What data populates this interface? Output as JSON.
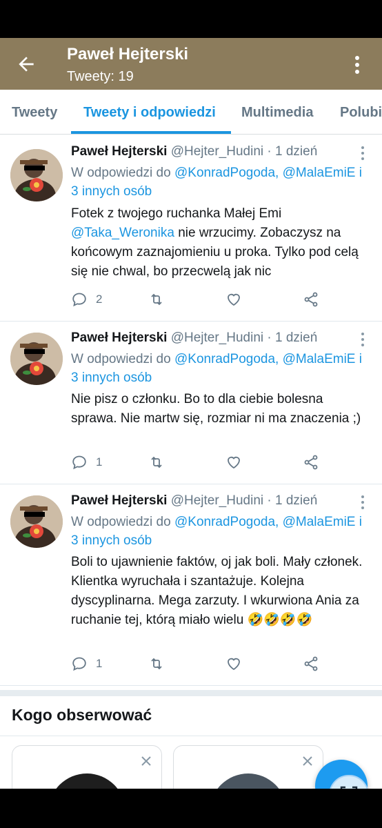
{
  "header": {
    "name": "Paweł Hejterski",
    "subtitle": "Tweety: 19"
  },
  "tabs": [
    {
      "label": "Tweety"
    },
    {
      "label": "Tweety i odpowiedzi"
    },
    {
      "label": "Multimedia"
    },
    {
      "label": "Polubi"
    }
  ],
  "tweets": [
    {
      "name": "Paweł Hejterski",
      "handle": "@Hejter_Hudini",
      "time": "· 1 dzień",
      "reply_prefix": "W odpowiedzi do",
      "reply_user1": "@KonradPogoda,",
      "reply_user2": "@MalaEmiE",
      "reply_rest": "i 3 innych osób",
      "text_a": "Fotek z twojego ruchanka Małej Emi",
      "mention": "@Taka_Weronika",
      "text_b": "nie wrzucimy. Zobaczysz na końcowym zaznajomieniu u proka. Tylko pod celą się nie chwal, bo przecwelą jak nic",
      "replies": "2"
    },
    {
      "name": "Paweł Hejterski",
      "handle": "@Hejter_Hudini",
      "time": "· 1 dzień",
      "reply_prefix": "W odpowiedzi do",
      "reply_user1": "@KonradPogoda,",
      "reply_user2": "@MalaEmiE",
      "reply_rest": "i 3 innych osób",
      "text": "Nie pisz o członku. Bo to dla ciebie bolesna sprawa. Nie martw się, rozmiar ni ma znaczenia ;)",
      "replies": "1"
    },
    {
      "name": "Paweł Hejterski",
      "handle": "@Hejter_Hudini",
      "time": "· 1 dzień",
      "reply_prefix": "W odpowiedzi do",
      "reply_user1": "@KonradPogoda,",
      "reply_user2": "@MalaEmiE",
      "reply_rest": "i 3 innych osób",
      "text": "Boli to ujawnienie faktów, oj jak boli. Mały członek. Klientka wyruchała i szantażuje. Kolejna dyscyplinarna. Mega zarzuty. I wkurwiona Ania za ruchanie tej, którą miało wielu 🤣🤣🤣🤣",
      "replies": "1"
    }
  ],
  "who_to_follow": {
    "title": "Kogo obserwować"
  },
  "colors": {
    "header_bg": "#8c7c5c",
    "accent": "#1b95e0",
    "muted": "#657786"
  },
  "icons": [
    "back-arrow-icon",
    "more-vert-icon",
    "caret-icon",
    "reply-icon",
    "retweet-icon",
    "like-icon",
    "share-icon",
    "close-icon",
    "compose-icon",
    "lens-icon"
  ]
}
